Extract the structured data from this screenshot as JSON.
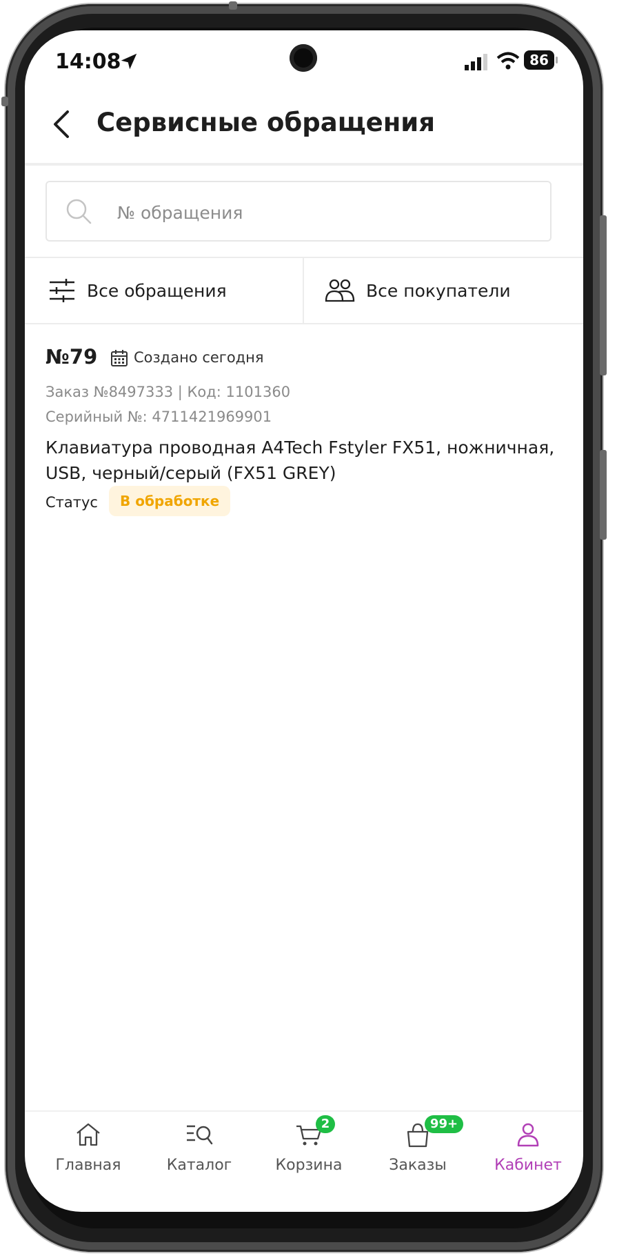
{
  "status_bar": {
    "time": "14:08",
    "battery": "86"
  },
  "header": {
    "title": "Сервисные обращения"
  },
  "search": {
    "placeholder": "№ обращения"
  },
  "filters": {
    "all_label": "Все обращения",
    "buyers_label": "Все покупатели"
  },
  "tickets": [
    {
      "number": "№79",
      "created": "Создано сегодня",
      "order_line": "Заказ №8497333 | Код: 1101360",
      "serial_line": "Серийный №: 4711421969901",
      "product": "Клавиатура проводная A4Tech Fstyler FX51, ножничная, USB, черный/серый (FX51 GREY)",
      "status_label": "Статус",
      "status": "В обработке",
      "status_color": "#f0a500"
    }
  ],
  "nav": {
    "items": [
      {
        "label": "Главная",
        "icon": "home-icon"
      },
      {
        "label": "Каталог",
        "icon": "catalog-search-icon"
      },
      {
        "label": "Корзина",
        "icon": "cart-icon",
        "badge": "2"
      },
      {
        "label": "Заказы",
        "icon": "bag-icon",
        "badge": "99+"
      },
      {
        "label": "Кабинет",
        "icon": "profile-icon",
        "active": true
      }
    ],
    "active_color": "#b13fb6",
    "badge_color": "#1fbe45"
  }
}
